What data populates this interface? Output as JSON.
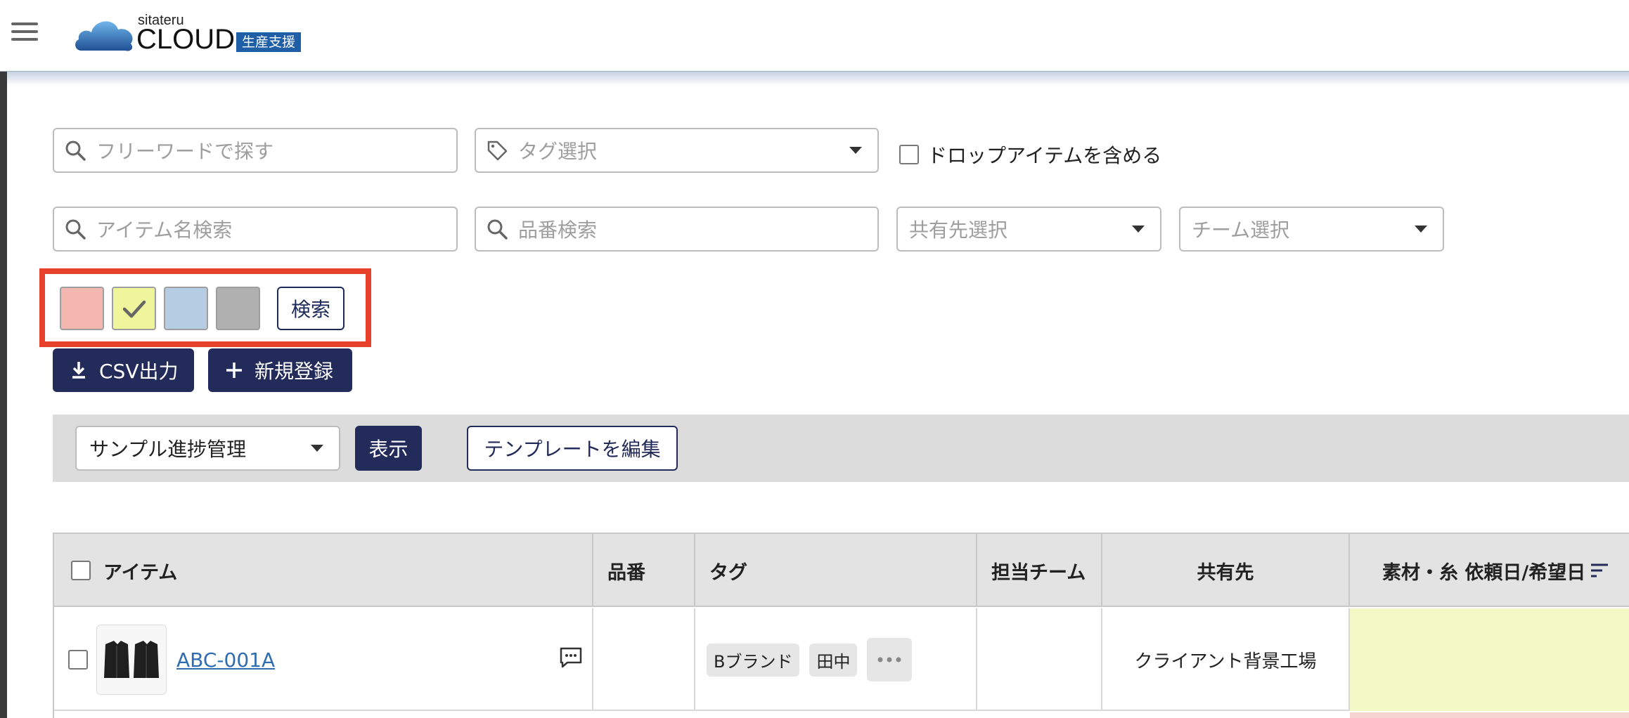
{
  "header": {
    "logo_small": "sitateru",
    "logo_big": "CLOUD",
    "logo_badge": "生産支援"
  },
  "filters": {
    "freeword_placeholder": "フリーワードで探す",
    "tag_placeholder": "タグ選択",
    "include_drop_label": "ドロップアイテムを含める",
    "item_name_placeholder": "アイテム名検索",
    "part_number_placeholder": "品番検索",
    "share_select_placeholder": "共有先選択",
    "team_select_placeholder": "チーム選択"
  },
  "color_filter": {
    "swatches": [
      {
        "name": "pink",
        "color": "#f4b6b0",
        "checked": false
      },
      {
        "name": "lime",
        "color": "#eef59b",
        "checked": true
      },
      {
        "name": "blue",
        "color": "#b6cce2",
        "checked": false
      },
      {
        "name": "gray",
        "color": "#b0b0b0",
        "checked": false
      }
    ],
    "search_label": "検索"
  },
  "actions": {
    "csv_label": "CSV出力",
    "new_label": "新規登録"
  },
  "template_bar": {
    "selected_template": "サンプル進捗管理",
    "show_label": "表示",
    "edit_label": "テンプレートを編集"
  },
  "table": {
    "headers": {
      "item": "アイテム",
      "part_number": "品番",
      "tag": "タグ",
      "team": "担当チーム",
      "share": "共有先",
      "material": "素材・糸 依頼日/希望日"
    },
    "rows": [
      {
        "item_code": "ABC-001A",
        "part_number": "",
        "tags": [
          "Bブランド",
          "田中"
        ],
        "team": "",
        "share": "クライアント背景工場",
        "material_color": "#f2f9c6"
      }
    ]
  },
  "colors": {
    "primary": "#222b59",
    "highlight": "#e8412b",
    "link": "#2f6db0"
  }
}
